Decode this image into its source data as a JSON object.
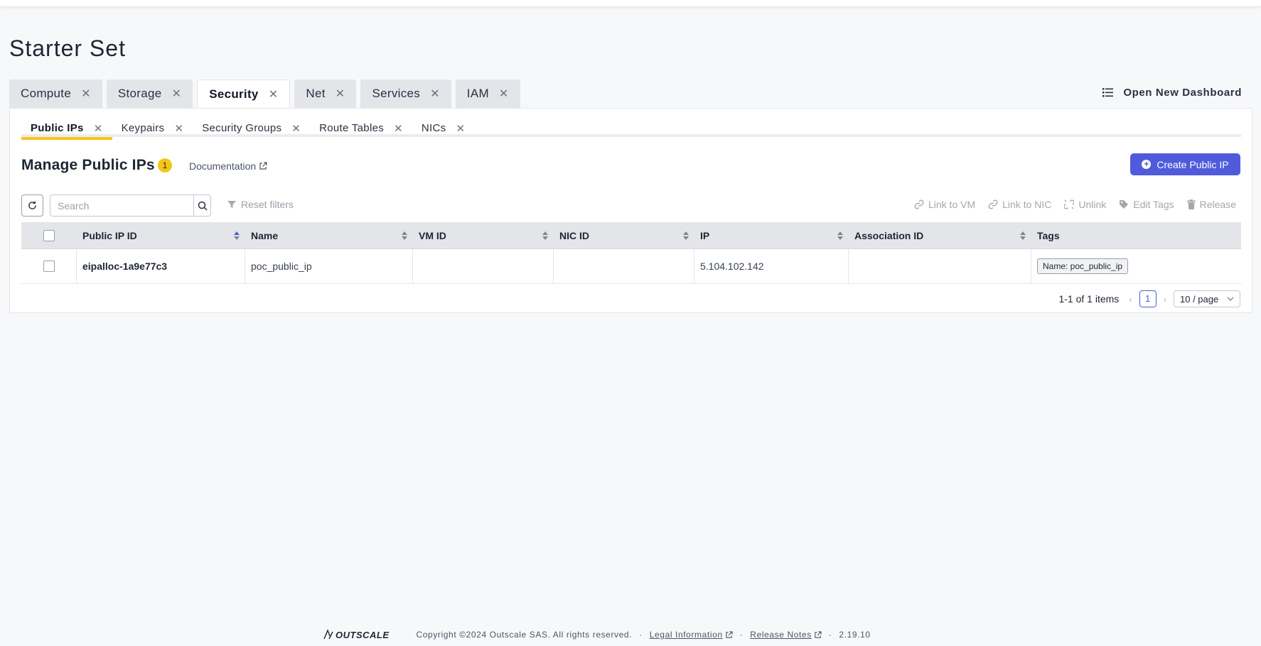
{
  "page": {
    "title": "Starter Set"
  },
  "top_tabs": [
    {
      "label": "Compute",
      "active": false
    },
    {
      "label": "Storage",
      "active": false
    },
    {
      "label": "Security",
      "active": true
    },
    {
      "label": "Net",
      "active": false
    },
    {
      "label": "Services",
      "active": false
    },
    {
      "label": "IAM",
      "active": false
    }
  ],
  "open_dashboard_label": "Open New Dashboard",
  "sub_tabs": [
    {
      "label": "Public IPs",
      "active": true
    },
    {
      "label": "Keypairs",
      "active": false
    },
    {
      "label": "Security Groups",
      "active": false
    },
    {
      "label": "Route Tables",
      "active": false
    },
    {
      "label": "NICs",
      "active": false
    }
  ],
  "manage": {
    "title": "Manage Public IPs",
    "count": "1",
    "documentation_label": "Documentation",
    "create_label": "Create Public IP"
  },
  "toolbar": {
    "search_placeholder": "Search",
    "reset_filters_label": "Reset filters",
    "actions": {
      "link_vm": "Link to VM",
      "link_nic": "Link to NIC",
      "unlink": "Unlink",
      "edit_tags": "Edit Tags",
      "release": "Release"
    }
  },
  "table": {
    "columns": [
      "Public IP ID",
      "Name",
      "VM ID",
      "NIC ID",
      "IP",
      "Association ID",
      "Tags"
    ],
    "rows": [
      {
        "public_ip_id": "eipalloc-1a9e77c3",
        "name": "poc_public_ip",
        "vm_id": "",
        "nic_id": "",
        "ip": "5.104.102.142",
        "association_id": "",
        "tags": "Name: poc_public_ip"
      }
    ]
  },
  "pagination": {
    "summary": "1-1 of 1 items",
    "current_page": "1",
    "page_size": "10 / page"
  },
  "footer": {
    "logo": "OUTSCALE",
    "copyright": "Copyright ©2024 Outscale SAS. All rights reserved.",
    "legal": "Legal Information",
    "release_notes": "Release Notes",
    "version": "2.19.10"
  },
  "colors": {
    "accent": "#4f5bdb",
    "highlight": "#f5c518",
    "tab_inactive_bg": "#e3e5e8"
  }
}
